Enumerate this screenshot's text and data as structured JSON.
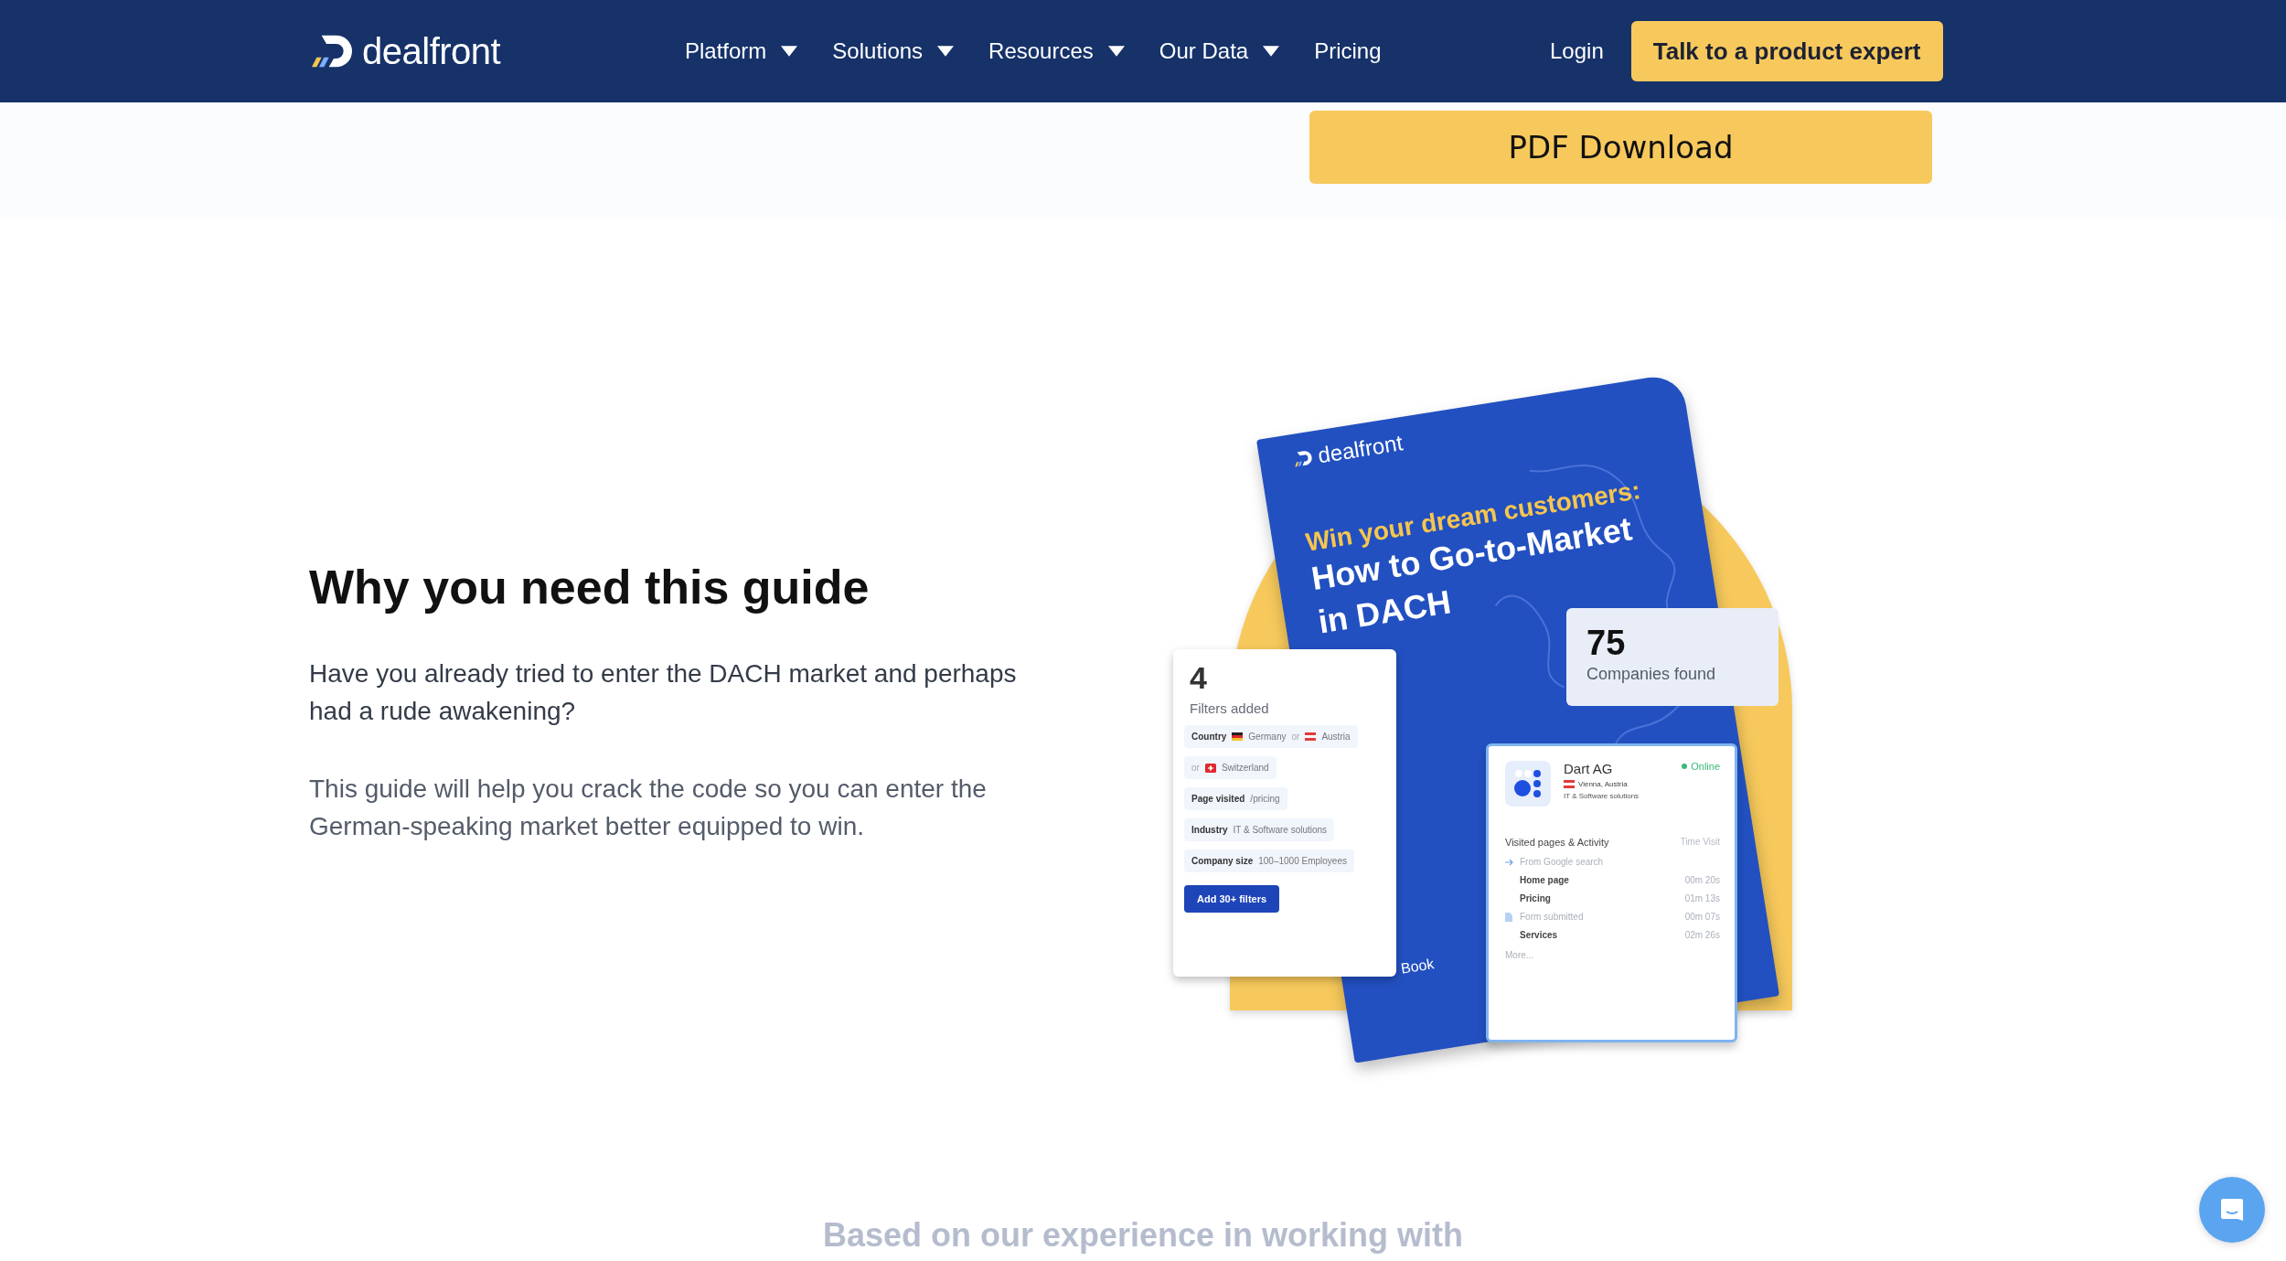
{
  "nav": {
    "logo": "dealfront",
    "items": [
      {
        "label": "Platform",
        "dropdown": true
      },
      {
        "label": "Solutions",
        "dropdown": true
      },
      {
        "label": "Resources",
        "dropdown": true
      },
      {
        "label": "Our Data",
        "dropdown": true
      },
      {
        "label": "Pricing",
        "dropdown": false
      }
    ],
    "login": "Login",
    "cta": "Talk to a product expert"
  },
  "pdf_button": "PDF Download",
  "guide": {
    "heading": "Why you need this guide",
    "paragraphs": [
      {
        "kind": "lead",
        "text": "Have you already tried to enter the DACH market and perhaps had a rude awakening?"
      },
      {
        "kind": "body",
        "text": "This guide will help you crack the code so you can enter the German-speaking market better equipped to win."
      }
    ]
  },
  "illustration": {
    "book": {
      "brand": "dealfront",
      "kicker": "Win your dream customers:",
      "title": "How to Go-to-Market in DACH",
      "footer": "Book"
    },
    "stats_card": {
      "value": "75",
      "label": "Companies found"
    },
    "filters_card": {
      "count": "4",
      "label": "Filters added",
      "chips": [
        {
          "parts": [
            {
              "kind": "label",
              "text": "Country"
            },
            {
              "kind": "flag_de"
            },
            {
              "kind": "value",
              "text": "Germany"
            },
            {
              "kind": "or",
              "text": "or"
            },
            {
              "kind": "flag_at"
            },
            {
              "kind": "value",
              "text": "Austria"
            }
          ]
        },
        {
          "parts": [
            {
              "kind": "or",
              "text": "or"
            },
            {
              "kind": "flag_ch"
            },
            {
              "kind": "value",
              "text": "Switzerland"
            }
          ]
        },
        {
          "parts": [
            {
              "kind": "label",
              "text": "Page visited"
            },
            {
              "kind": "value",
              "text": "/pricing"
            }
          ]
        },
        {
          "parts": [
            {
              "kind": "label",
              "text": "Industry"
            },
            {
              "kind": "value",
              "text": "IT & Software solutions"
            }
          ]
        },
        {
          "parts": [
            {
              "kind": "label",
              "text": "Company size"
            },
            {
              "kind": "value",
              "text": "100–1000 Employees"
            }
          ]
        }
      ],
      "button": "Add 30+ filters"
    },
    "company_card": {
      "name": "Dart AG",
      "status": "Online",
      "online": true,
      "location": {
        "kind": "flag_at",
        "text": "Vienna, Austria"
      },
      "industry": "IT & Software solutions",
      "activity_header": "Visited pages & Activity",
      "time_header": "Time Visit",
      "rows": [
        {
          "kind": "source",
          "text": "From Google search"
        },
        {
          "kind": "page",
          "text": "Home page",
          "time": "00m 20s"
        },
        {
          "kind": "page",
          "text": "Pricing",
          "time": "01m 13s"
        },
        {
          "kind": "event",
          "text": "Form submitted",
          "time": "00m 07s"
        },
        {
          "kind": "page",
          "text": "Services",
          "time": "02m 26s"
        }
      ],
      "more": "More..."
    }
  },
  "next_section_heading": "Based on our experience in working with"
}
